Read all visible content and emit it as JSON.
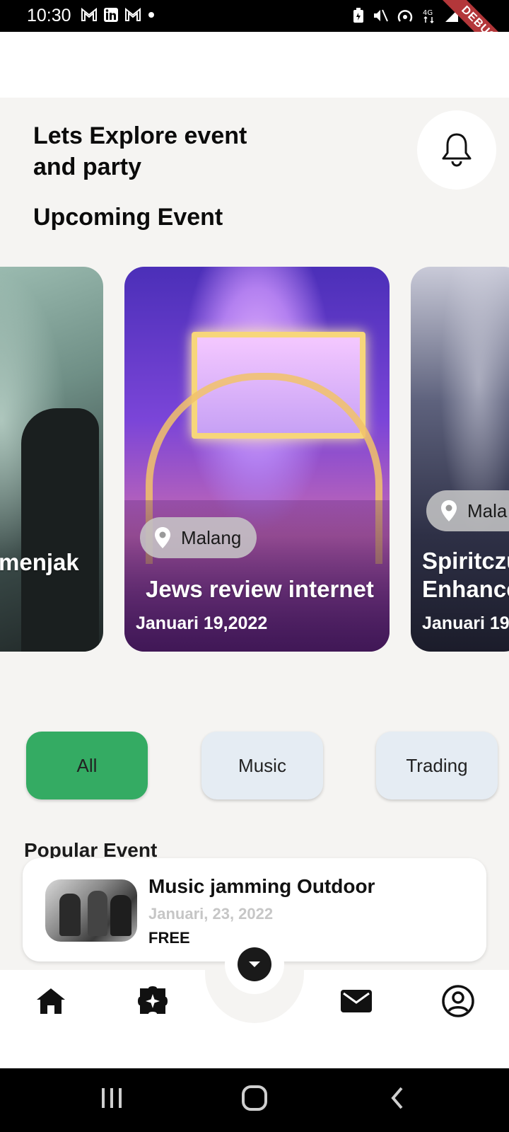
{
  "status_bar": {
    "time": "10:30",
    "debug_label": "DEBUG",
    "left_icons": [
      "gmail-icon",
      "linkedin-icon",
      "gmail-icon",
      "dot-icon"
    ],
    "right_icons": [
      "battery-saver-icon",
      "mute-icon",
      "hotspot-icon",
      "4g-signal-icon",
      "signal-icon",
      "battery-icon"
    ]
  },
  "header": {
    "title": "Lets Explore event and party",
    "bell_icon": "bell-icon"
  },
  "upcoming": {
    "section_title": "Upcoming Event",
    "cards": [
      {
        "title": "menjak",
        "location": "",
        "date": ""
      },
      {
        "title": "Jews review internet",
        "location": "Malang",
        "date": "Januari 19,2022"
      },
      {
        "title": "Spiritczu Enhance",
        "location": "Mala",
        "date": "Januari 19"
      }
    ]
  },
  "categories": [
    {
      "label": "All",
      "active": true,
      "color": "#34ab63"
    },
    {
      "label": "Music",
      "active": false,
      "color": "#e5ecf3"
    },
    {
      "label": "Trading",
      "active": false,
      "color": "#e5ecf3"
    }
  ],
  "popular": {
    "section_title": "Popular Event",
    "items": [
      {
        "title": "Music jamming Outdoor",
        "date": "Januari, 23, 2022",
        "price": "FREE"
      }
    ]
  },
  "bottom_nav": {
    "items": [
      "home-icon",
      "puzzle-icon",
      "expand-icon",
      "mail-icon",
      "account-icon"
    ]
  },
  "system_nav": [
    "recents-icon",
    "home-circle-icon",
    "back-icon"
  ]
}
